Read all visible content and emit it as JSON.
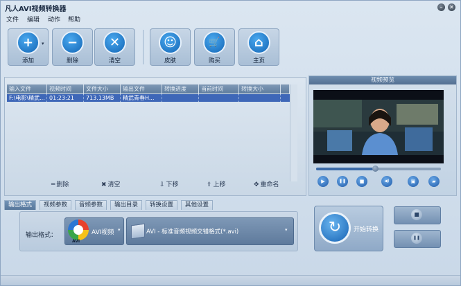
{
  "window": {
    "title": "凡人AVI视频转换器",
    "minimize_symbol": "–",
    "close_symbol": "✕"
  },
  "menu": [
    "文件",
    "编辑",
    "动作",
    "帮助"
  ],
  "toolbar": [
    {
      "label": "添加",
      "icon": "add-icon",
      "glyph": "+"
    },
    {
      "label": "删除",
      "icon": "remove-icon",
      "glyph": "−"
    },
    {
      "label": "清空",
      "icon": "clear-icon",
      "glyph": "✕"
    },
    {
      "label": "皮肤",
      "icon": "skin-icon",
      "glyph": "☺"
    },
    {
      "label": "购买",
      "icon": "cart-icon",
      "glyph": "🛒"
    },
    {
      "label": "主页",
      "icon": "home-icon",
      "glyph": "⌂"
    }
  ],
  "toolbar_dropdown_symbol": "▾",
  "file_table": {
    "columns": [
      "输入文件",
      "视频时间",
      "文件大小",
      "输出文件",
      "转换进度",
      "当前时间",
      "转换大小"
    ],
    "rows": [
      [
        "F:\\电影\\精武...",
        "01:23:21",
        "713.13MB",
        "精武青春H...",
        "",
        "",
        ""
      ]
    ]
  },
  "list_actions": [
    {
      "label": "删除",
      "icon": "minus-icon",
      "glyph": "━"
    },
    {
      "label": "清空",
      "icon": "x-icon",
      "glyph": "✖"
    },
    {
      "label": "下移",
      "icon": "arrow-down-icon",
      "glyph": "⇩"
    },
    {
      "label": "上移",
      "icon": "arrow-up-icon",
      "glyph": "⇧"
    },
    {
      "label": "重命名",
      "icon": "rename-icon",
      "glyph": "✥"
    }
  ],
  "preview": {
    "title": "视频预览",
    "seek_progress": 0.47,
    "controls": [
      {
        "name": "play",
        "glyph": "▶"
      },
      {
        "name": "pause",
        "glyph": "❚❚"
      },
      {
        "name": "stop",
        "glyph": "■"
      },
      {
        "name": "volume",
        "glyph": "◀)"
      },
      {
        "name": "snapshot",
        "glyph": "▣"
      },
      {
        "name": "folder",
        "glyph": "▰"
      }
    ]
  },
  "settings_tabs": [
    "输出格式",
    "视频参数",
    "音频参数",
    "输出目录",
    "转换设置",
    "其他设置"
  ],
  "active_tab": 0,
  "output_format": {
    "label": "输出格式：",
    "format_value": "AVI视频",
    "format_badge": "AVI",
    "profile_value": "AVI - 标准音频视频交错格式(*.avi)",
    "dropdown_symbol": "▾"
  },
  "convert": {
    "start_label": "开始转换",
    "start_glyph": "↻",
    "stop_glyph": "■",
    "pause_glyph": "❚❚"
  },
  "colors": {
    "accent": "#1a63b4",
    "selected_row": "#3e67b8",
    "header": "#5f7d9e"
  }
}
